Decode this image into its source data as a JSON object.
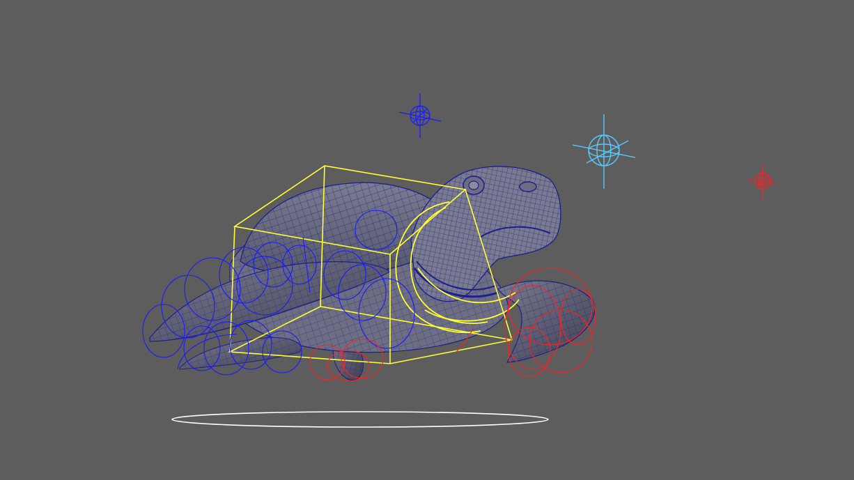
{
  "viewport": {
    "background": "#5d5d5d"
  },
  "colors": {
    "mesh_fill": "#6e6f84",
    "mesh_shade": "#4d4f63",
    "wireframe": "#1d1f8a",
    "control_left": "#1a1aff",
    "control_right": "#ff2020",
    "control_cog": "#ffff33",
    "locator_blue": "#1a1aff",
    "locator_cyan": "#55ccff",
    "locator_red": "#ff2020",
    "ground_ring": "#ffffff"
  },
  "icons": {
    "locator_blue": "crosshair-sphere-icon",
    "locator_cyan": "crosshair-sphere-icon",
    "locator_red": "crosshair-sphere-icon"
  }
}
